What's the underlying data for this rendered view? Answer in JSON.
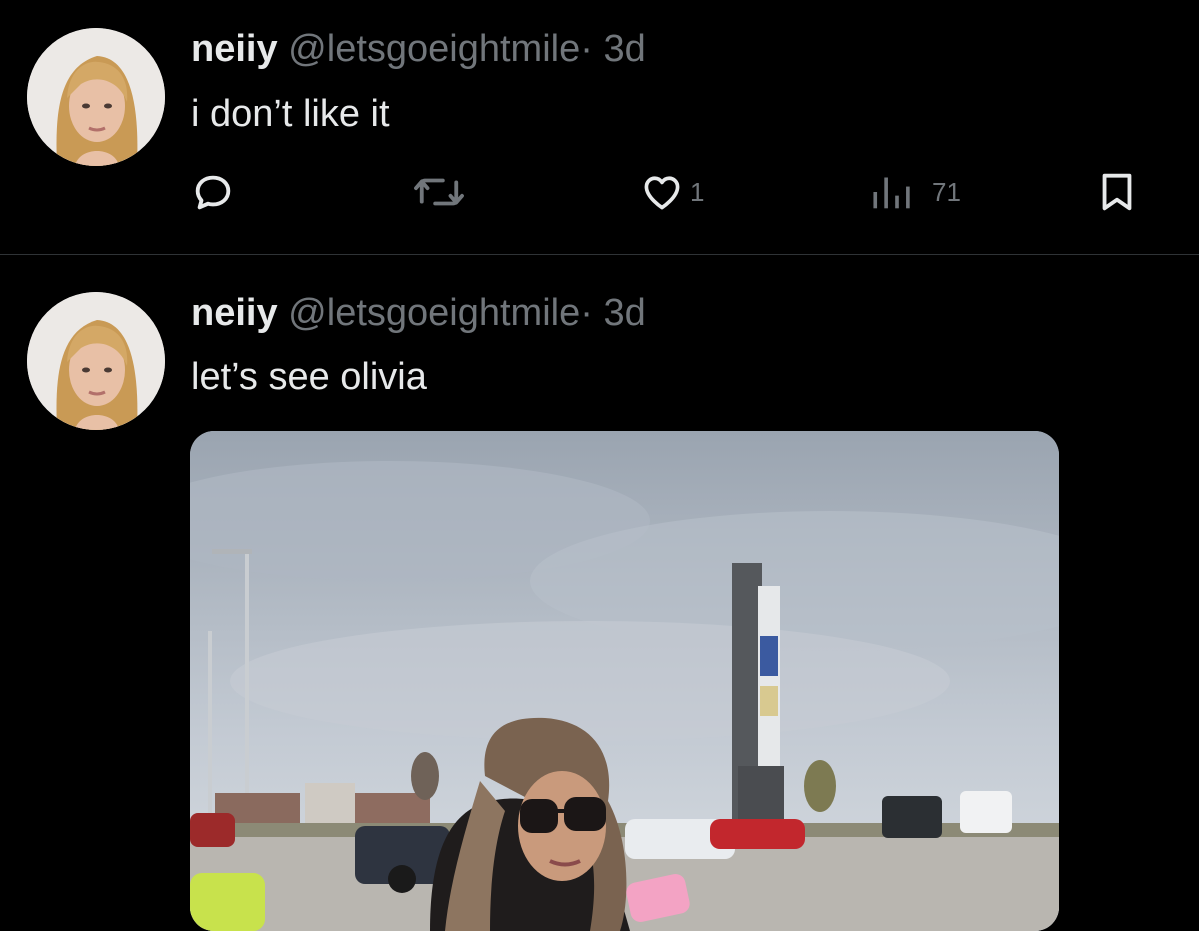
{
  "tweets": [
    {
      "user": {
        "name": "neiiy",
        "handle": "@letsgoeightmile",
        "separator": "·",
        "time": "3d",
        "avatar": "woman-portrait-avatar"
      },
      "text": "i don’t like it",
      "actions": {
        "reply": {
          "icon": "reply-icon",
          "count": ""
        },
        "retweet": {
          "icon": "retweet-icon",
          "count": ""
        },
        "like": {
          "icon": "heart-icon",
          "count": "1"
        },
        "views": {
          "icon": "views-chart-icon",
          "count": "71"
        },
        "bookmark": {
          "icon": "bookmark-icon"
        }
      }
    },
    {
      "user": {
        "name": "neiiy",
        "handle": "@letsgoeightmile",
        "separator": "·",
        "time": "3d",
        "avatar": "woman-portrait-avatar"
      },
      "text": "let’s see olivia",
      "media": {
        "type": "photo",
        "subject": "woman-in-sunglasses-parking-lot-photo"
      }
    }
  ],
  "colors": {
    "background": "#000000",
    "primary_text": "#e7e9ea",
    "secondary_text": "#71767b",
    "divider": "#2f3336"
  }
}
